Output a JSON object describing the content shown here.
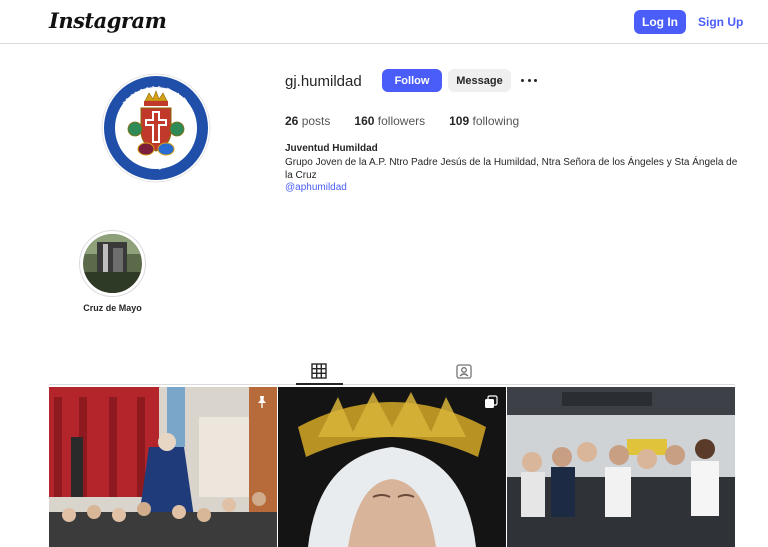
{
  "brand": {
    "logo_text": "Instagram"
  },
  "nav": {
    "login_label": "Log In",
    "signup_label": "Sign Up"
  },
  "profile": {
    "username": "gj.humildad",
    "follow_label": "Follow",
    "message_label": "Message",
    "stats": {
      "posts_count": "26",
      "posts_label": "posts",
      "followers_count": "160",
      "followers_label": "followers",
      "following_count": "109",
      "following_label": "following"
    },
    "full_name": "Juventud Humildad",
    "bio": "Grupo Joven de la A.P. Ntro Padre Jesús de la Humildad, Ntra Señora de los Ángeles y Sta Ángela de la Cruz",
    "link": "@aphumildad",
    "crest_top_text": "HUMILDAD",
    "crest_bottom_text": "GRUPO JOVEN"
  },
  "highlights": [
    {
      "label": "Cruz de Mayo"
    }
  ],
  "tabs": [
    {
      "name": "posts",
      "icon": "grid-icon",
      "active": true
    },
    {
      "name": "tagged",
      "icon": "tagged-icon",
      "active": false
    }
  ],
  "posts": [
    {
      "icon": "pin-icon"
    },
    {
      "icon": "carousel-icon"
    },
    {
      "icon": ""
    }
  ],
  "colors": {
    "accent": "#4a5df9",
    "border": "#dbdbdb",
    "crest_blue": "#1f4fa8"
  }
}
